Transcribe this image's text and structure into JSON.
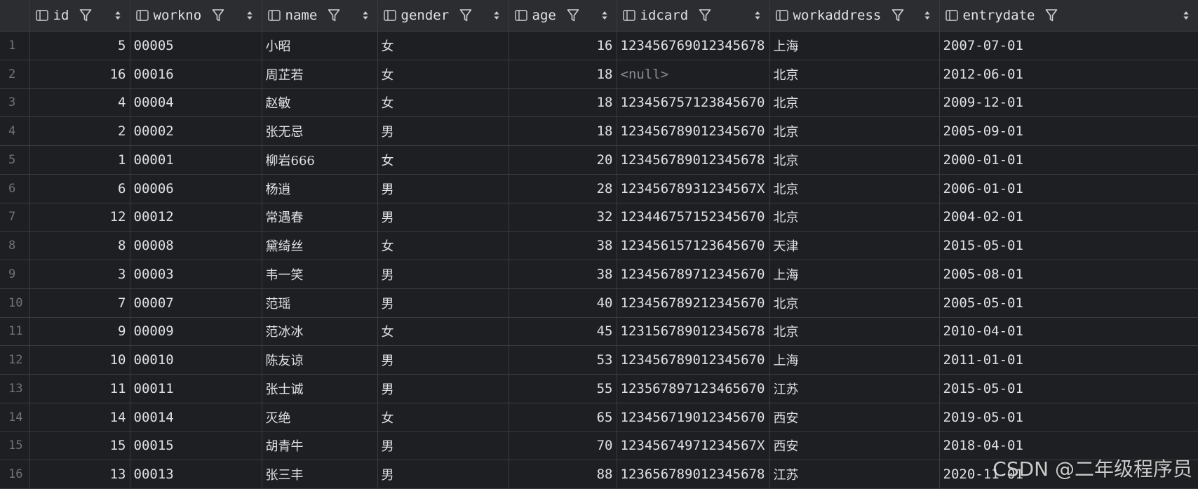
{
  "colors": {
    "background": "#1e1f22",
    "header_background": "#2b2d30",
    "grid_line": "#393b40",
    "text": "#dfe1e5",
    "row_number": "#6f737a",
    "null_text": "#868a91"
  },
  "columns": [
    {
      "key": "id",
      "label": "id",
      "align": "right",
      "icon": "column-icon",
      "filter_icon": "filter-icon",
      "sort_icon": "sort-icon"
    },
    {
      "key": "workno",
      "label": "workno",
      "align": "left",
      "icon": "column-icon",
      "filter_icon": "filter-icon",
      "sort_icon": "sort-icon"
    },
    {
      "key": "name",
      "label": "name",
      "align": "left",
      "icon": "column-icon",
      "filter_icon": "filter-icon",
      "sort_icon": "sort-icon"
    },
    {
      "key": "gender",
      "label": "gender",
      "align": "left",
      "icon": "column-icon",
      "filter_icon": "filter-icon",
      "sort_icon": "sort-icon"
    },
    {
      "key": "age",
      "label": "age",
      "align": "right",
      "icon": "column-icon",
      "filter_icon": "filter-icon",
      "sort_icon": "sort-icon"
    },
    {
      "key": "idcard",
      "label": "idcard",
      "align": "left",
      "icon": "column-icon",
      "filter_icon": "filter-icon",
      "sort_icon": "sort-icon"
    },
    {
      "key": "workaddress",
      "label": "workaddress",
      "align": "left",
      "icon": "column-icon",
      "filter_icon": "filter-icon",
      "sort_icon": "sort-icon"
    },
    {
      "key": "entrydate",
      "label": "entrydate",
      "align": "left",
      "icon": "column-icon",
      "filter_icon": "filter-icon",
      "sort_icon": "sort-icon"
    }
  ],
  "rows": [
    {
      "rownum": "1",
      "id": "5",
      "workno": "00005",
      "name": "小昭",
      "gender": "女",
      "age": "16",
      "idcard": "123456769012345678",
      "workaddress": "上海",
      "entrydate": "2007-07-01"
    },
    {
      "rownum": "2",
      "id": "16",
      "workno": "00016",
      "name": "周芷若",
      "gender": "女",
      "age": "18",
      "idcard": "<null>",
      "workaddress": "北京",
      "entrydate": "2012-06-01"
    },
    {
      "rownum": "3",
      "id": "4",
      "workno": "00004",
      "name": "赵敏",
      "gender": "女",
      "age": "18",
      "idcard": "123456757123845670",
      "workaddress": "北京",
      "entrydate": "2009-12-01"
    },
    {
      "rownum": "4",
      "id": "2",
      "workno": "00002",
      "name": "张无忌",
      "gender": "男",
      "age": "18",
      "idcard": "123456789012345670",
      "workaddress": "北京",
      "entrydate": "2005-09-01"
    },
    {
      "rownum": "5",
      "id": "1",
      "workno": "00001",
      "name": "柳岩666",
      "gender": "女",
      "age": "20",
      "idcard": "123456789012345678",
      "workaddress": "北京",
      "entrydate": "2000-01-01"
    },
    {
      "rownum": "6",
      "id": "6",
      "workno": "00006",
      "name": "杨逍",
      "gender": "男",
      "age": "28",
      "idcard": "12345678931234567X",
      "workaddress": "北京",
      "entrydate": "2006-01-01"
    },
    {
      "rownum": "7",
      "id": "12",
      "workno": "00012",
      "name": "常遇春",
      "gender": "男",
      "age": "32",
      "idcard": "123446757152345670",
      "workaddress": "北京",
      "entrydate": "2004-02-01"
    },
    {
      "rownum": "8",
      "id": "8",
      "workno": "00008",
      "name": "黛绮丝",
      "gender": "女",
      "age": "38",
      "idcard": "123456157123645670",
      "workaddress": "天津",
      "entrydate": "2015-05-01"
    },
    {
      "rownum": "9",
      "id": "3",
      "workno": "00003",
      "name": "韦一笑",
      "gender": "男",
      "age": "38",
      "idcard": "123456789712345670",
      "workaddress": "上海",
      "entrydate": "2005-08-01"
    },
    {
      "rownum": "10",
      "id": "7",
      "workno": "00007",
      "name": "范瑶",
      "gender": "男",
      "age": "40",
      "idcard": "123456789212345670",
      "workaddress": "北京",
      "entrydate": "2005-05-01"
    },
    {
      "rownum": "11",
      "id": "9",
      "workno": "00009",
      "name": "范冰冰",
      "gender": "女",
      "age": "45",
      "idcard": "123156789012345678",
      "workaddress": "北京",
      "entrydate": "2010-04-01"
    },
    {
      "rownum": "12",
      "id": "10",
      "workno": "00010",
      "name": "陈友谅",
      "gender": "男",
      "age": "53",
      "idcard": "123456789012345670",
      "workaddress": "上海",
      "entrydate": "2011-01-01"
    },
    {
      "rownum": "13",
      "id": "11",
      "workno": "00011",
      "name": "张士诚",
      "gender": "男",
      "age": "55",
      "idcard": "123567897123465670",
      "workaddress": "江苏",
      "entrydate": "2015-05-01"
    },
    {
      "rownum": "14",
      "id": "14",
      "workno": "00014",
      "name": "灭绝",
      "gender": "女",
      "age": "65",
      "idcard": "123456719012345670",
      "workaddress": "西安",
      "entrydate": "2019-05-01"
    },
    {
      "rownum": "15",
      "id": "15",
      "workno": "00015",
      "name": "胡青牛",
      "gender": "男",
      "age": "70",
      "idcard": "12345674971234567X",
      "workaddress": "西安",
      "entrydate": "2018-04-01"
    },
    {
      "rownum": "16",
      "id": "13",
      "workno": "00013",
      "name": "张三丰",
      "gender": "男",
      "age": "88",
      "idcard": "123656789012345678",
      "workaddress": "江苏",
      "entrydate": "2020-11-01"
    }
  ],
  "watermark": "CSDN @二年级程序员"
}
